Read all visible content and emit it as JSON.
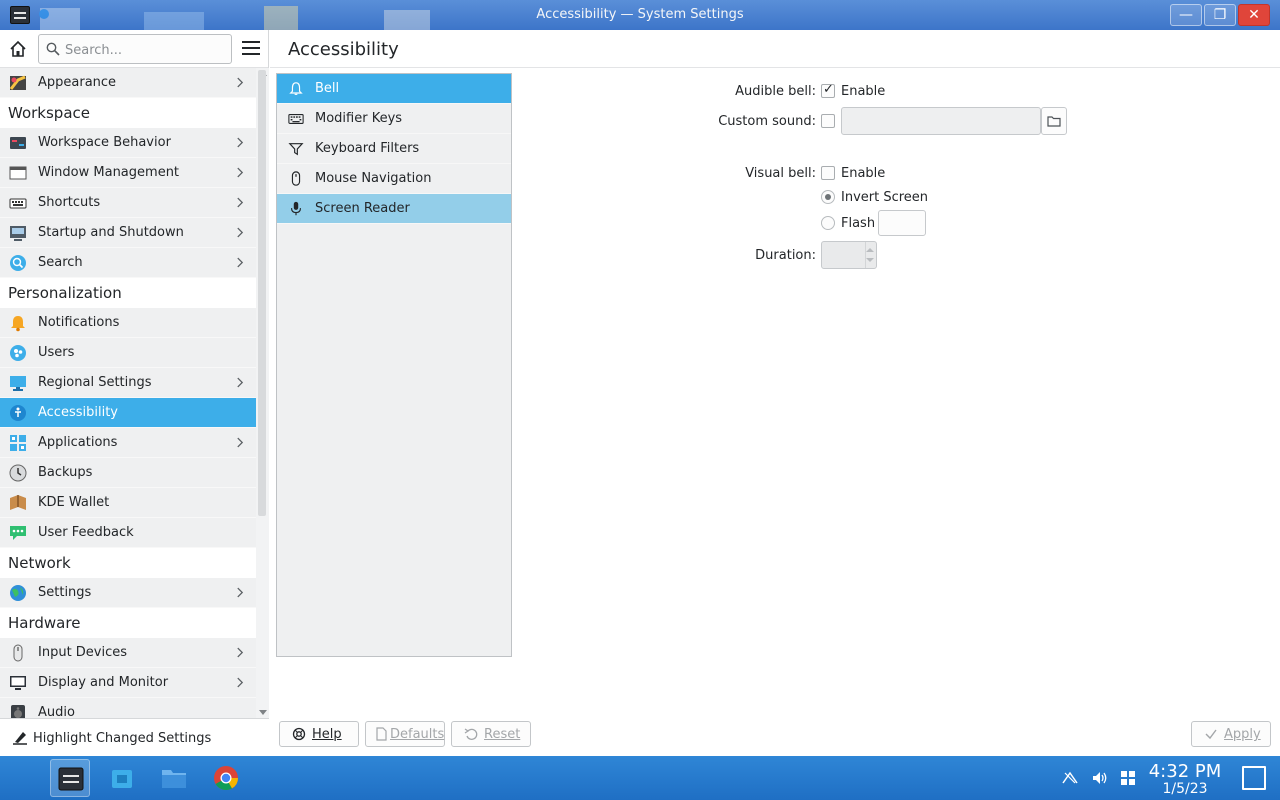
{
  "window": {
    "title": "Accessibility — System Settings",
    "minimize_glyph": "—",
    "maximize_glyph": "❐",
    "close_glyph": "✕"
  },
  "sidebar": {
    "search_placeholder": "Search...",
    "sections": [
      {
        "category": "",
        "items": [
          {
            "label": "Appearance",
            "icon": "appearance-icon",
            "chevron": true
          }
        ]
      },
      {
        "category": "Workspace",
        "items": [
          {
            "label": "Workspace Behavior",
            "icon": "workspace-behavior-icon",
            "chevron": true
          },
          {
            "label": "Window Management",
            "icon": "window-management-icon",
            "chevron": true
          },
          {
            "label": "Shortcuts",
            "icon": "keyboard-icon",
            "chevron": true
          },
          {
            "label": "Startup and Shutdown",
            "icon": "startup-icon",
            "chevron": true
          },
          {
            "label": "Search",
            "icon": "search-icon",
            "chevron": true
          }
        ]
      },
      {
        "category": "Personalization",
        "items": [
          {
            "label": "Notifications",
            "icon": "bell-icon",
            "chevron": false
          },
          {
            "label": "Users",
            "icon": "users-icon",
            "chevron": false
          },
          {
            "label": "Regional Settings",
            "icon": "regional-icon",
            "chevron": true
          },
          {
            "label": "Accessibility",
            "icon": "accessibility-icon",
            "chevron": false,
            "active": true
          },
          {
            "label": "Applications",
            "icon": "applications-icon",
            "chevron": true
          },
          {
            "label": "Backups",
            "icon": "backups-icon",
            "chevron": false
          },
          {
            "label": "KDE Wallet",
            "icon": "wallet-icon",
            "chevron": false
          },
          {
            "label": "User Feedback",
            "icon": "feedback-icon",
            "chevron": false
          }
        ]
      },
      {
        "category": "Network",
        "items": [
          {
            "label": "Settings",
            "icon": "globe-icon",
            "chevron": true
          }
        ]
      },
      {
        "category": "Hardware",
        "items": [
          {
            "label": "Input Devices",
            "icon": "mouse-icon",
            "chevron": true
          },
          {
            "label": "Display and Monitor",
            "icon": "monitor-icon",
            "chevron": true
          },
          {
            "label": "Audio",
            "icon": "audio-icon",
            "chevron": false
          }
        ]
      }
    ],
    "highlight_changed": "Highlight Changed Settings"
  },
  "main": {
    "title": "Accessibility",
    "subnav": [
      {
        "label": "Bell",
        "icon": "bell-icon",
        "state": "active"
      },
      {
        "label": "Modifier Keys",
        "icon": "keyboard-icon",
        "state": ""
      },
      {
        "label": "Keyboard Filters",
        "icon": "filter-icon",
        "state": ""
      },
      {
        "label": "Mouse Navigation",
        "icon": "mouse-icon",
        "state": ""
      },
      {
        "label": "Screen Reader",
        "icon": "microphone-icon",
        "state": "hover"
      }
    ],
    "bell": {
      "audible_label": "Audible bell:",
      "audible_enable": "Enable",
      "audible_checked": true,
      "custom_sound_label": "Custom sound:",
      "custom_sound_value": "",
      "visual_label": "Visual bell:",
      "visual_enable": "Enable",
      "visual_checked": false,
      "invert_screen": "Invert Screen",
      "flash": "Flash",
      "duration_label": "Duration:",
      "duration_value": ""
    },
    "buttons": {
      "help": "Help",
      "defaults": "Defaults",
      "reset": "Reset",
      "apply": "Apply"
    }
  },
  "taskbar": {
    "time": "4:32 PM",
    "date": "1/5/23"
  }
}
